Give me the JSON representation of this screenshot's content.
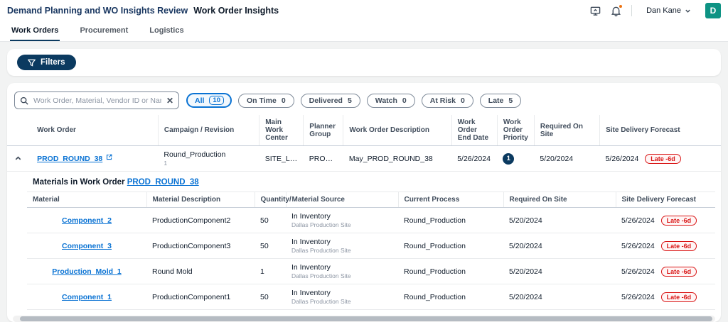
{
  "colors": {
    "accent_blue": "#0972d3",
    "navy": "#0b3a60",
    "late_red": "#d91515",
    "avatar_teal": "#0e9384",
    "notification_orange": "#ec7211"
  },
  "topbar": {
    "app_title": "Demand Planning and WO Insights Review",
    "page_title": "Work Order Insights",
    "user_name": "Dan Kane",
    "avatar_initial": "D"
  },
  "tabs": [
    {
      "label": "Work Orders"
    },
    {
      "label": "Procurement"
    },
    {
      "label": "Logistics"
    }
  ],
  "filters": {
    "button_label": "Filters"
  },
  "search": {
    "placeholder": "Work Order, Material, Vendor ID or Name"
  },
  "status_chips": [
    {
      "label": "All",
      "count": "10"
    },
    {
      "label": "On Time",
      "count": "0"
    },
    {
      "label": "Delivered",
      "count": "5"
    },
    {
      "label": "Watch",
      "count": "0"
    },
    {
      "label": "At Risk",
      "count": "0"
    },
    {
      "label": "Late",
      "count": "5"
    }
  ],
  "work_order_table": {
    "columns": {
      "work_order": "Work Order",
      "campaign": "Campaign / Revision",
      "main_work_center": "Main Work Center",
      "planner_group": "Planner Group",
      "description": "Work Order Description",
      "end_date": "Work Order End Date",
      "priority": "Work Order Priority",
      "required_on_site": "Required On Site",
      "forecast": "Site Delivery Forecast"
    },
    "row": {
      "work_order": "PROD_ROUND_38",
      "campaign": "Round_Production",
      "revision": "1",
      "main_work_center": "SITE_LEAD",
      "planner_group": "PROD_PL...",
      "description": "May_PROD_ROUND_38",
      "end_date": "5/26/2024",
      "priority": "1",
      "required_on_site": "5/20/2024",
      "forecast_date": "5/26/2024",
      "forecast_badge": "Late -6d"
    }
  },
  "materials": {
    "title_prefix": "Materials in Work Order",
    "work_order_link": "PROD_ROUND_38",
    "columns": {
      "material": "Material",
      "description": "Material Description",
      "quantity": "Quantity/",
      "source": "Material Source",
      "current_process": "Current Process",
      "required_on_site": "Required On Site",
      "forecast": "Site Delivery Forecast"
    },
    "rows": [
      {
        "material": "Component_2",
        "description": "ProductionComponent2",
        "quantity": "50",
        "source": "In Inventory",
        "source_site": "Dallas Production Site",
        "current_process": "Round_Production",
        "required_on_site": "5/20/2024",
        "forecast_date": "5/26/2024",
        "forecast_badge": "Late -6d"
      },
      {
        "material": "Component_3",
        "description": "ProductionComponent3",
        "quantity": "50",
        "source": "In Inventory",
        "source_site": "Dallas Production Site",
        "current_process": "Round_Production",
        "required_on_site": "5/20/2024",
        "forecast_date": "5/26/2024",
        "forecast_badge": "Late -6d"
      },
      {
        "material": "Production_Mold_1",
        "description": "Round Mold",
        "quantity": "1",
        "source": "In Inventory",
        "source_site": "Dallas Production Site",
        "current_process": "Round_Production",
        "required_on_site": "5/20/2024",
        "forecast_date": "5/26/2024",
        "forecast_badge": "Late -6d"
      },
      {
        "material": "Component_1",
        "description": "ProductionComponent1",
        "quantity": "50",
        "source": "In Inventory",
        "source_site": "Dallas Production Site",
        "current_process": "Round_Production",
        "required_on_site": "5/20/2024",
        "forecast_date": "5/26/2024",
        "forecast_badge": "Late -6d"
      }
    ]
  }
}
